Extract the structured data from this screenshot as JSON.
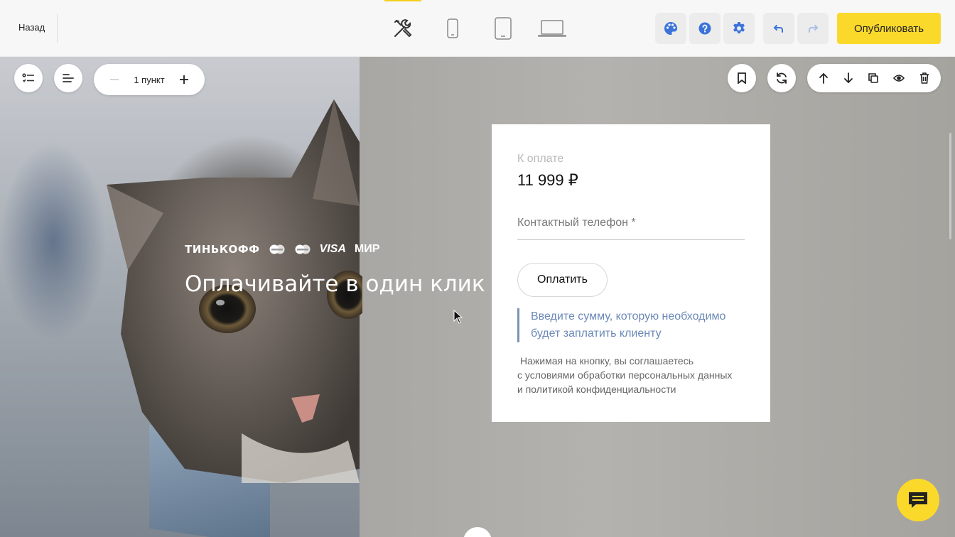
{
  "toolbar": {
    "back_label": "Назад",
    "publish_label": "Опубликовать",
    "accent_color": "#fbd92b",
    "devices": [
      "tools-icon",
      "phone-icon",
      "tablet-icon",
      "laptop-icon"
    ],
    "active_device": "tools-icon"
  },
  "block_controls": {
    "items_count_label": "1 пункт"
  },
  "hero": {
    "logos": {
      "tinkoff": "ТИНЬКОФФ",
      "visa": "VISA",
      "mir": "МИР"
    },
    "title": "Оплачивайте в один клик"
  },
  "payment_card": {
    "due_label": "К оплате",
    "amount": "11 999 ₽",
    "phone_placeholder": "Контактный телефон *",
    "pay_button": "Оплатить",
    "hint": "Введите сумму, которую необходимо будет заплатить клиенту",
    "terms_line1": "Нажимая на кнопку, вы соглашаетесь",
    "terms_line2": "с условиями обработки персональных данных",
    "terms_line3": "и политикой конфиденциальности",
    "hint_color": "#6b89b8"
  }
}
